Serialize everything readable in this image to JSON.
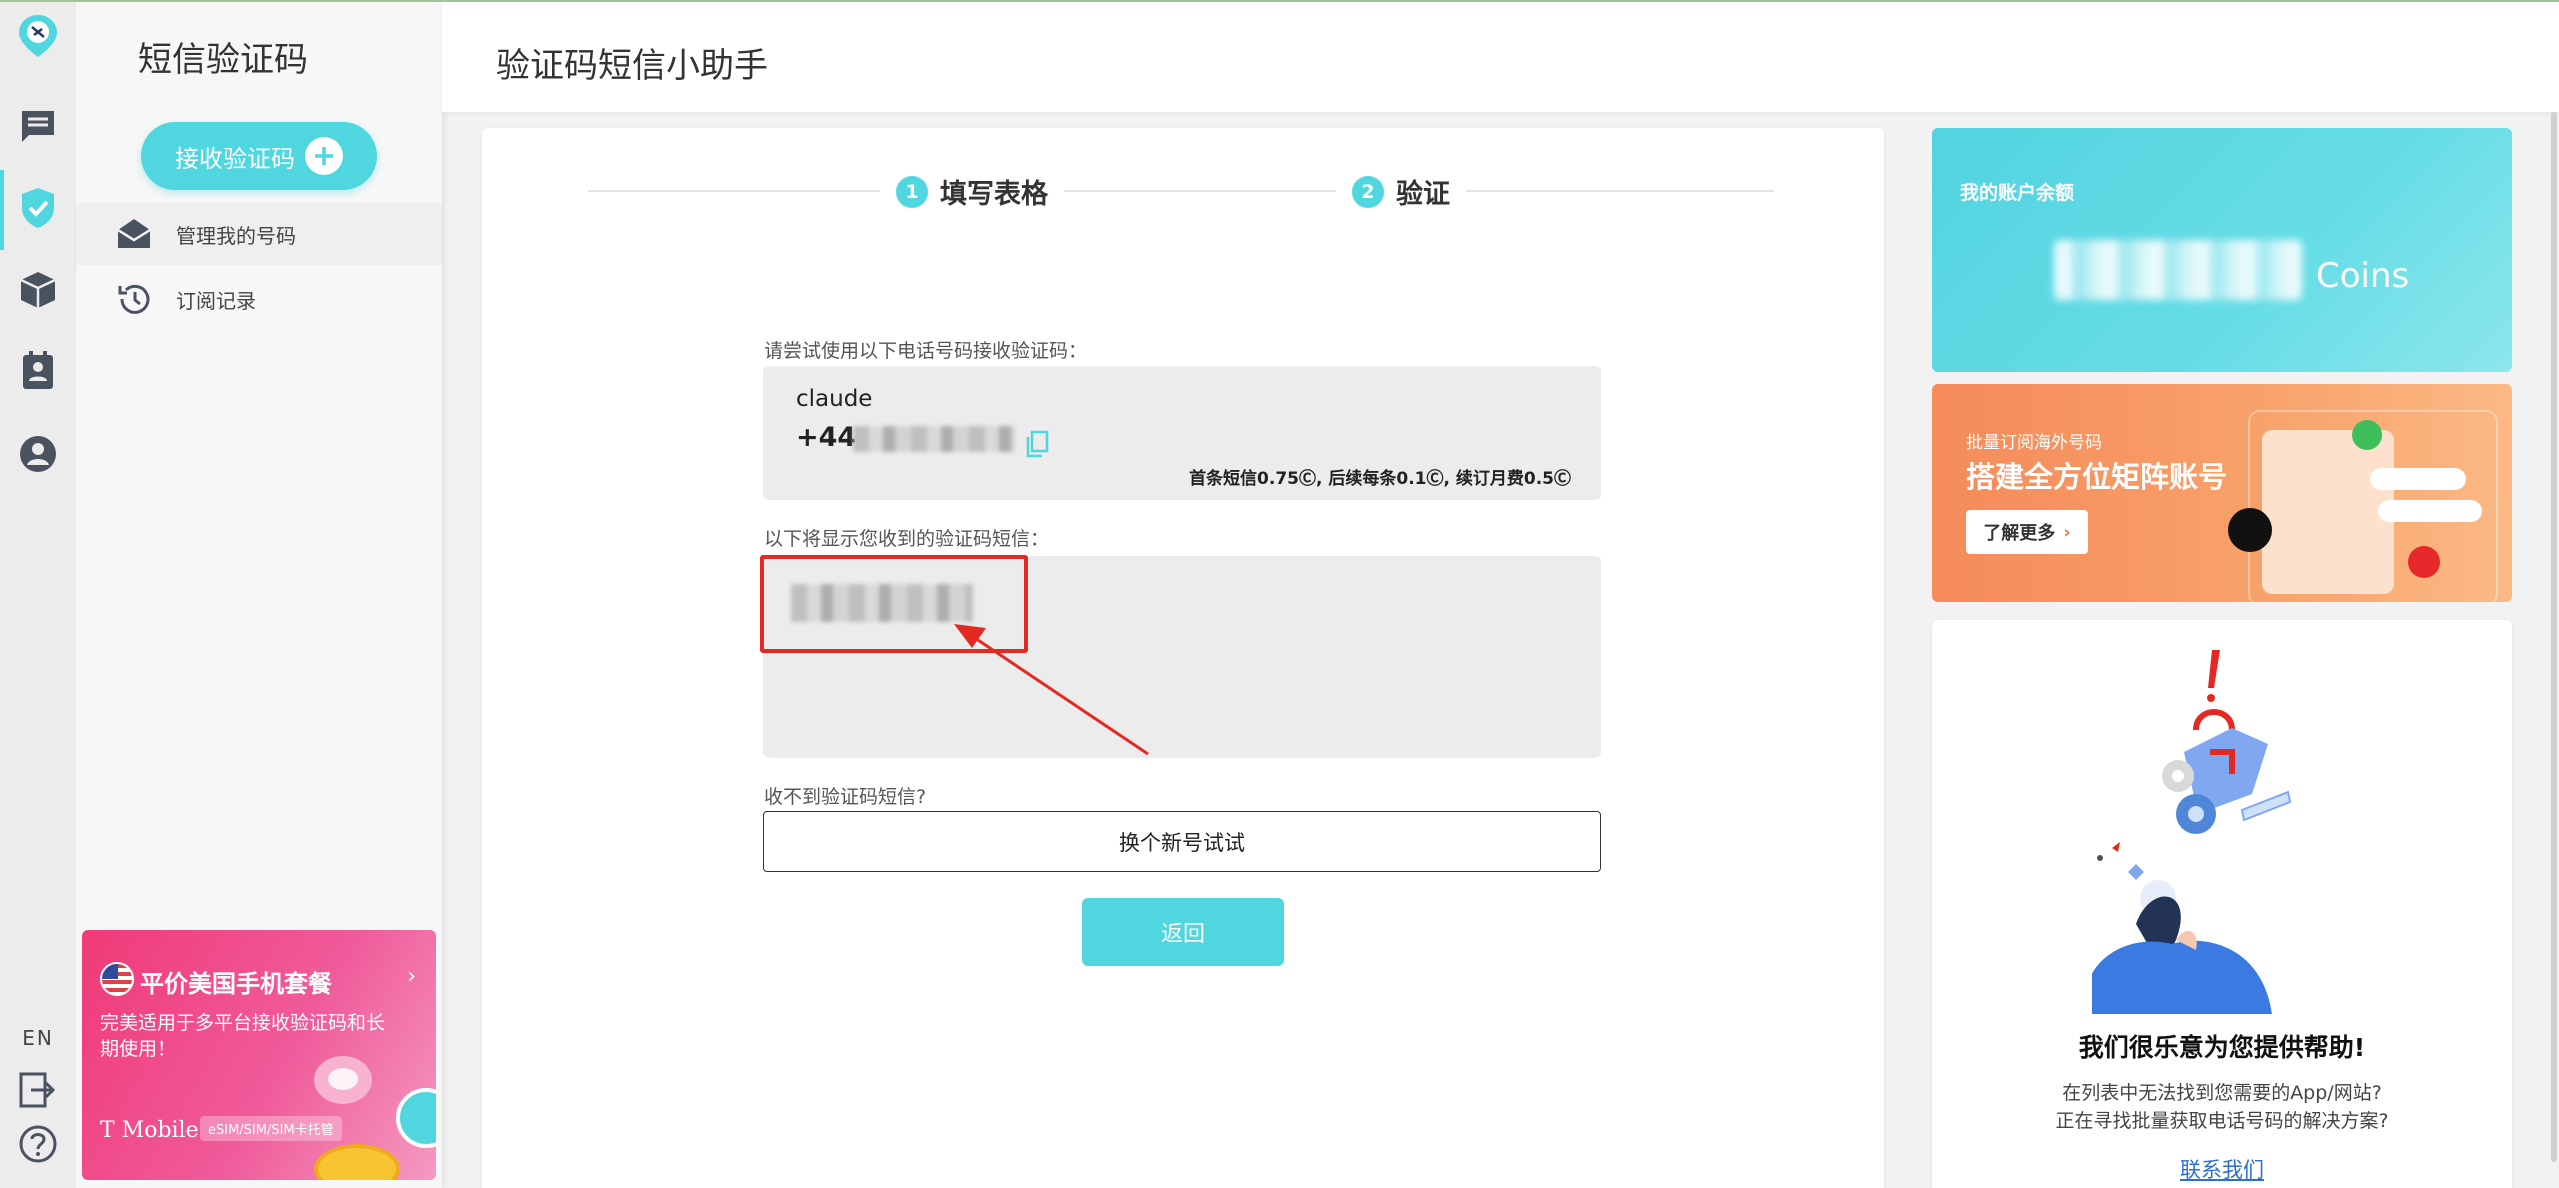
{
  "rail": {
    "items": [
      "logo-icon",
      "chat-icon",
      "shield-check-icon",
      "box-icon",
      "contacts-icon",
      "user-icon"
    ],
    "lang": "EN",
    "bottom": [
      "logout-icon",
      "help-icon"
    ]
  },
  "sidebar": {
    "title": "短信验证码",
    "receive_button": "接收验证码",
    "items": [
      {
        "label": "管理我的号码",
        "icon": "envelope-open-icon"
      },
      {
        "label": "订阅记录",
        "icon": "history-icon"
      }
    ],
    "promo": {
      "title": "平价美国手机套餐",
      "desc": "完美适用于多平台接收验证码和长期使用！",
      "brand": "T Mobile",
      "tag": "eSIM/SIM/SIM卡托管"
    }
  },
  "header": {
    "title": "验证码短信小助手"
  },
  "main": {
    "steps": [
      {
        "num": "1",
        "label": "填写表格"
      },
      {
        "num": "2",
        "label": "验证"
      }
    ],
    "number_prompt": "请尝试使用以下电话号码接收验证码：",
    "service_name": "claude",
    "country_code": "+44",
    "price_text": "首条短信0.75Ⓒ, 后续每条0.1Ⓒ, 续订月费0.5Ⓒ",
    "sms_prompt": "以下将显示您收到的验证码短信：",
    "not_received": "收不到验证码短信?",
    "change_button": "换个新号试试",
    "back_button": "返回"
  },
  "right": {
    "balance_title": "我的账户余额",
    "balance_unit": "Coins",
    "banner_small": "批量订阅海外号码",
    "banner_title": "搭建全方位矩阵账号",
    "banner_button": "了解更多",
    "help_title": "我们很乐意为您提供帮助!",
    "help_line1": "在列表中无法找到您需要的App/网站?",
    "help_line2": "正在寻找批量获取电话号码的解决方案?",
    "help_link": "联系我们"
  },
  "colors": {
    "accent": "#4fd6df",
    "annotation": "#e32a22",
    "link": "#2d6fcf"
  }
}
